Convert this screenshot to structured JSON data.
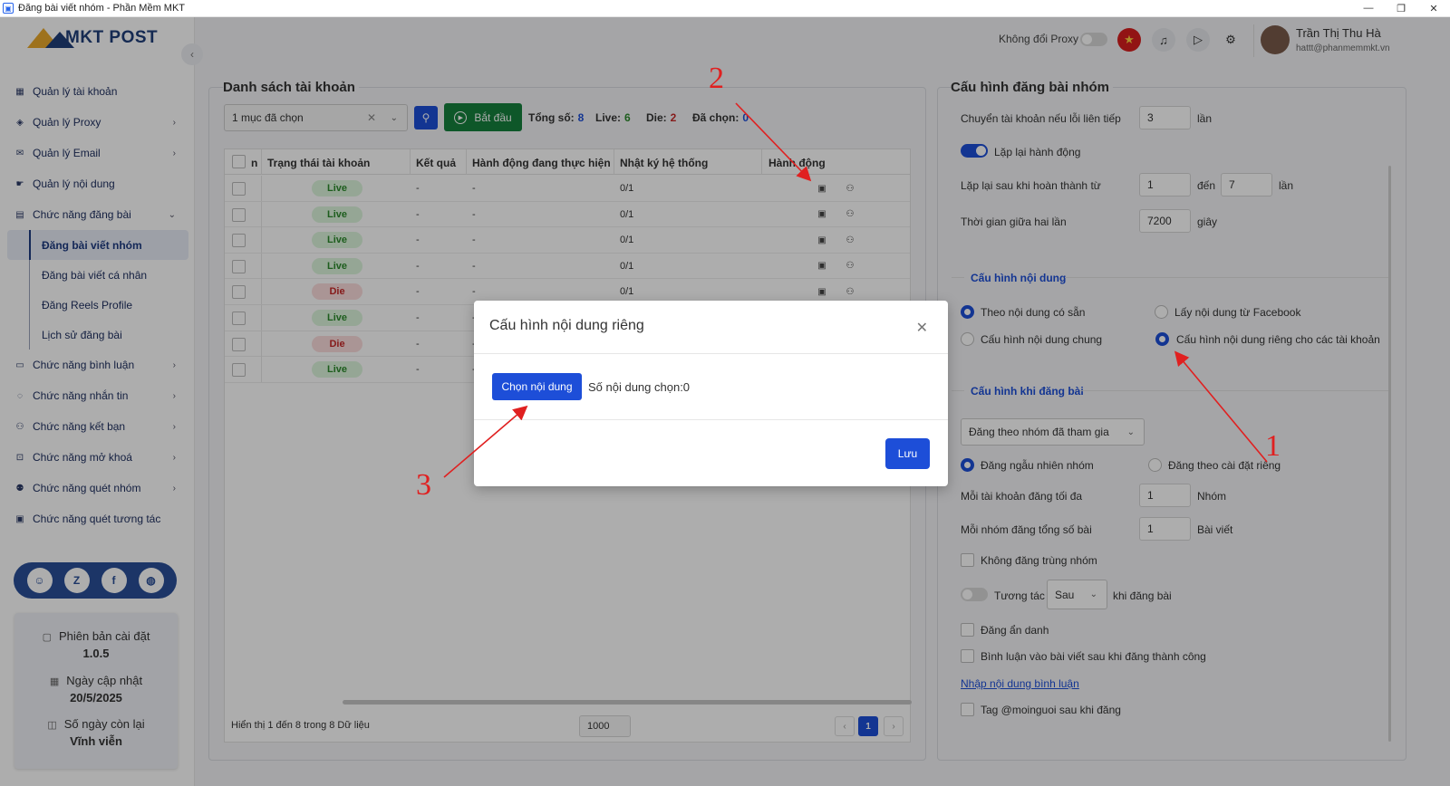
{
  "window": {
    "title": "Đăng bài viết nhóm - Phần Mềm MKT"
  },
  "brand": {
    "name": "MKT POST",
    "accent": "#1d4ed8",
    "logo_gold": "#e9a92c",
    "logo_navy": "#1f3e7a"
  },
  "sidebar": {
    "items": [
      {
        "label": "Quản lý tài khoản",
        "icon": "grid-icon",
        "chevron": false
      },
      {
        "label": "Quản lý Proxy",
        "icon": "layers-icon",
        "chevron": true
      },
      {
        "label": "Quản lý Email",
        "icon": "mail-icon",
        "chevron": true
      },
      {
        "label": "Quản lý nội dung",
        "icon": "hand-icon",
        "chevron": false
      },
      {
        "label": "Chức năng đăng bài",
        "icon": "post-icon",
        "chevron": true,
        "expanded": true
      }
    ],
    "subitems": [
      {
        "label": "Đăng bài viết nhóm",
        "active": true
      },
      {
        "label": "Đăng bài viết cá nhân",
        "active": false
      },
      {
        "label": "Đăng Reels Profile",
        "active": false
      },
      {
        "label": "Lịch sử đăng bài",
        "active": false
      }
    ],
    "items2": [
      {
        "label": "Chức năng bình luận",
        "icon": "comment-icon"
      },
      {
        "label": "Chức năng nhắn tin",
        "icon": "chat-icon"
      },
      {
        "label": "Chức năng kết bạn",
        "icon": "add-friend-icon"
      },
      {
        "label": "Chức năng mở khoá",
        "icon": "lock-icon"
      },
      {
        "label": "Chức năng quét nhóm",
        "icon": "group-icon"
      },
      {
        "label": "Chức năng quét tương tác",
        "icon": "scan-icon"
      }
    ],
    "social_labels": [
      "support-icon",
      "zalo-icon",
      "facebook-icon",
      "globe-icon"
    ],
    "info": {
      "version_label": "Phiên bản cài đặt",
      "version": "1.0.5",
      "update_label": "Ngày cập nhật",
      "update": "20/5/2025",
      "days_label": "Số ngày còn lại",
      "days": "Vĩnh viễn"
    }
  },
  "topbar": {
    "proxy_label": "Không đổi Proxy",
    "user_name": "Trần Thị Thu Hà",
    "user_email": "hattt@phanmemmkt.vn"
  },
  "accounts": {
    "title": "Danh sách tài khoản",
    "select_value": "1 mục đã chọn",
    "start_label": "Bắt đầu",
    "total_label": "Tổng số:",
    "total": "8",
    "live_label": "Live:",
    "live": "6",
    "die_label": "Die:",
    "die": "2",
    "selected_label": "Đã chọn:",
    "selected": "0",
    "columns": [
      "n",
      "Trạng thái tài khoản",
      "Kết quả",
      "Hành động đang thực hiện",
      "Nhật ký hệ thống",
      "Hành động"
    ],
    "rows": [
      {
        "status": "Live",
        "result": "-",
        "action": "-",
        "log": "0/1"
      },
      {
        "status": "Live",
        "result": "-",
        "action": "-",
        "log": "0/1"
      },
      {
        "status": "Live",
        "result": "-",
        "action": "-",
        "log": "0/1"
      },
      {
        "status": "Live",
        "result": "-",
        "action": "-",
        "log": "0/1"
      },
      {
        "status": "Die",
        "result": "-",
        "action": "-",
        "log": "0/1"
      },
      {
        "status": "Live",
        "result": "-",
        "action": "-",
        "log": ""
      },
      {
        "status": "Die",
        "result": "-",
        "action": "-",
        "log": ""
      },
      {
        "status": "Live",
        "result": "-",
        "action": "-",
        "log": ""
      }
    ],
    "footer_text": "Hiển thị 1 đến 8 trong 8 Dữ liệu",
    "page_size": "1000",
    "current_page": "1",
    "prev": "‹",
    "next": "›"
  },
  "config": {
    "title": "Cấu hình đăng bài nhóm",
    "switch_label": "Chuyển tài khoản nếu lỗi liên tiếp",
    "switch_value": "3",
    "switch_unit": "lần",
    "repeat_label": "Lặp lại hành động",
    "repeat_from_label": "Lặp lại sau khi hoàn thành từ",
    "repeat_from": "1",
    "repeat_to_label": "đến",
    "repeat_to": "7",
    "repeat_unit": "lần",
    "interval_label": "Thời gian giữa hai lần",
    "interval": "7200",
    "interval_unit": "giây",
    "content_section": "Cấu hình nội dung",
    "content_opt1": "Theo nội dung có sẵn",
    "content_opt2": "Lấy nội dung từ Facebook",
    "content_opt3": "Cấu hình nội dung chung",
    "content_opt4": "Cấu hình nội dung riêng cho các tài khoản",
    "post_section": "Cấu hình khi đăng bài",
    "post_mode": "Đăng theo nhóm đã tham gia",
    "post_opt1": "Đăng ngẫu nhiên nhóm",
    "post_opt2": "Đăng theo cài đặt riêng",
    "max_label": "Mỗi tài khoản đăng tối đa",
    "max_value": "1",
    "max_unit": "Nhóm",
    "per_group_label": "Mỗi nhóm đăng tổng số bài",
    "per_group": "1",
    "per_group_unit": "Bài viết",
    "no_dup": "Không đăng trùng nhóm",
    "interact_label": "Tương tác",
    "interact_select": "Sau",
    "interact_suffix": "khi đăng bài",
    "anon": "Đăng ẩn danh",
    "comment": "Bình luận vào bài viết sau khi đăng thành công",
    "comment_link": "Nhập nội dung bình luận",
    "tag": "Tag @moinguoi sau khi đăng"
  },
  "modal": {
    "title": "Cấu hình nội dung riêng",
    "pick_label": "Chọn nội dung",
    "count_label": "Số nội dung chọn:0",
    "save_label": "Lưu"
  },
  "annotations": {
    "a1": "1",
    "a2": "2",
    "a3": "3",
    "color": "#e02020"
  }
}
